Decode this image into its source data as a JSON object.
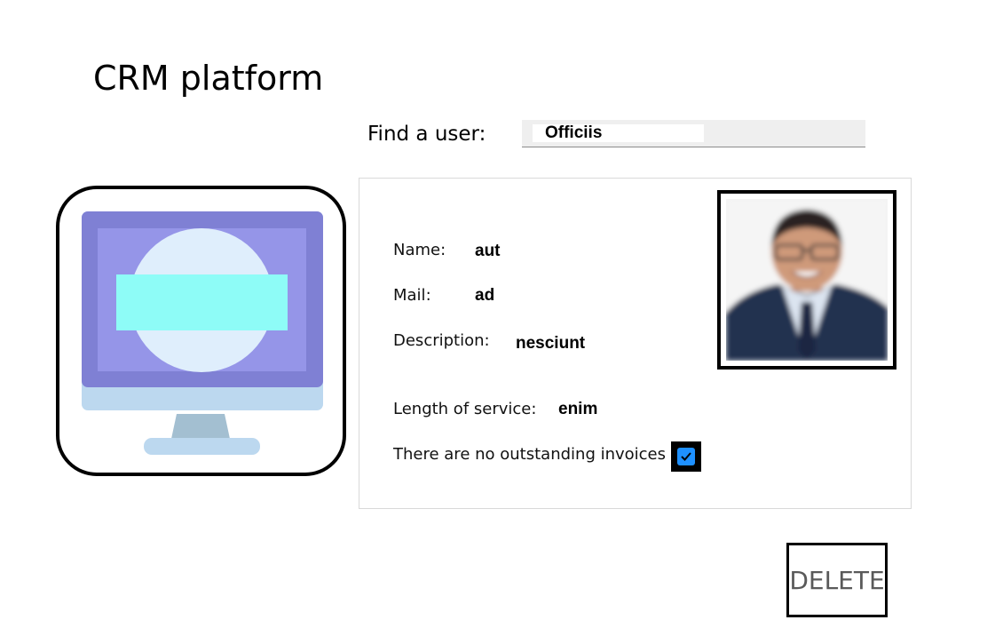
{
  "app": {
    "title": "CRM platform"
  },
  "search": {
    "label": "Find a user:",
    "value": "Officiis"
  },
  "user": {
    "name_label": "Name:",
    "name_value": "aut",
    "mail_label": "Mail:",
    "mail_value": "ad",
    "description_label": "Description:",
    "description_value": "nesciunt",
    "service_label": "Length of service:",
    "service_value": "enim",
    "invoices_label": "There are no outstanding invoices",
    "invoices_checked": true
  },
  "actions": {
    "delete_label": "DELETE"
  },
  "colors": {
    "checkbox_fill": "#1e90ff",
    "monitor_frame": "#7f80d4",
    "monitor_screen": "#9595e8",
    "monitor_circle": "#dfeefc",
    "monitor_bar": "#8efcf7",
    "monitor_stand": "#a3bfd1"
  }
}
